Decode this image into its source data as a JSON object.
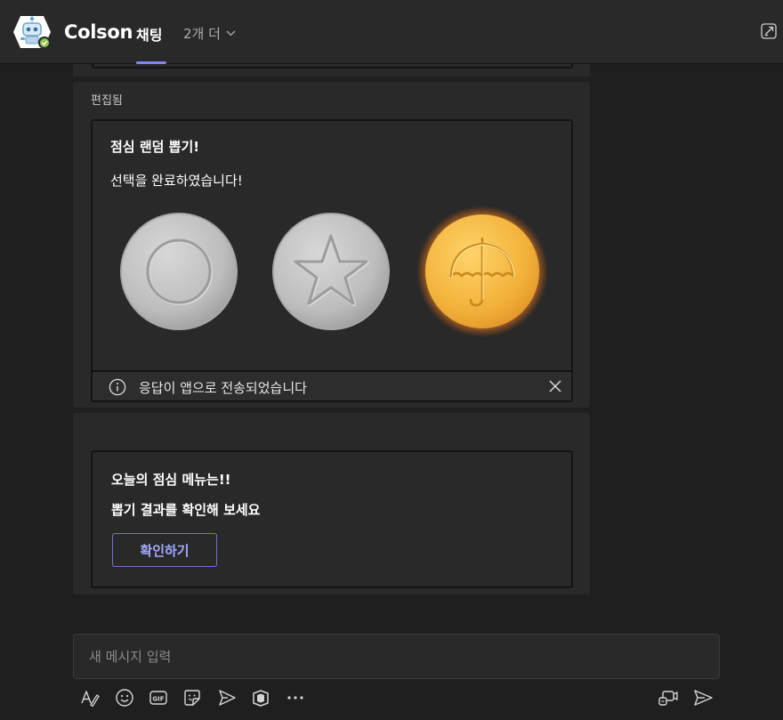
{
  "header": {
    "app_name": "Colson",
    "active_tab": "채팅",
    "more_tabs": "2개 더"
  },
  "message1": {
    "edited_label": "편집됨",
    "card": {
      "title": "점심 랜덤 뽑기!",
      "subtitle": "선택을 완료하였습니다!",
      "coins": [
        {
          "symbol": "circle",
          "color": "#c4c4c4",
          "selected": false
        },
        {
          "symbol": "star",
          "color": "#c4c4c4",
          "selected": false
        },
        {
          "symbol": "umbrella",
          "color": "#f2b23a",
          "selected": true
        }
      ]
    },
    "toast": {
      "text": "응답이 앱으로 전송되었습니다"
    }
  },
  "message2": {
    "card": {
      "line1": "오늘의 점심 메뉴는!!",
      "line2": "뽑기 결과를 확인해 보세요",
      "button_label": "확인하기"
    }
  },
  "compose": {
    "placeholder": "새 메시지 입력"
  },
  "toolbar": {
    "icons": [
      "format-icon",
      "emoji-icon",
      "gif-icon",
      "sticker-icon",
      "schedule-send-icon",
      "loop-icon",
      "more-icon",
      "meet-now-icon",
      "send-icon"
    ]
  },
  "colors": {
    "accent": "#7f85f5",
    "background": "#1f1f1f",
    "surface": "#292929",
    "selected_coin": "#f2b23a",
    "coin": "#c4c4c4"
  }
}
